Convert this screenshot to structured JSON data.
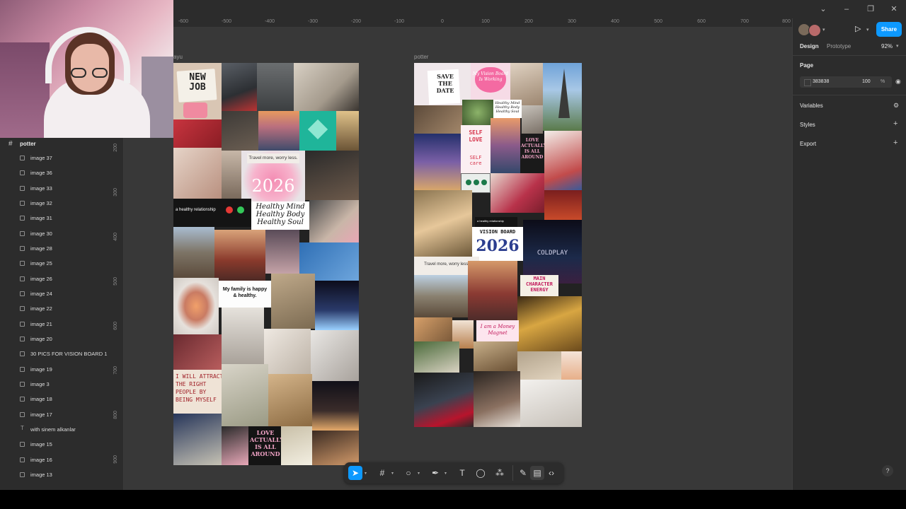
{
  "header": {
    "share_label": "Share",
    "mode_tabs": [
      "Design",
      "Prototype"
    ],
    "zoom": "92%"
  },
  "ruler": {
    "h_ticks": [
      "-600",
      "-500",
      "-400",
      "-300",
      "-200",
      "-100",
      "0",
      "100",
      "200",
      "300",
      "400",
      "500",
      "600",
      "700",
      "800"
    ],
    "v_ticks": [
      "200",
      "300",
      "400",
      "500",
      "600",
      "700",
      "800",
      "900"
    ]
  },
  "frames": [
    {
      "label": "ayu"
    },
    {
      "label": "potter"
    }
  ],
  "layers": {
    "root": "potter",
    "items": [
      {
        "label": "image 37",
        "kind": "image"
      },
      {
        "label": "image 36",
        "kind": "image"
      },
      {
        "label": "image 33",
        "kind": "image"
      },
      {
        "label": "image 32",
        "kind": "image"
      },
      {
        "label": "image 31",
        "kind": "image"
      },
      {
        "label": "image 30",
        "kind": "image"
      },
      {
        "label": "image 28",
        "kind": "image"
      },
      {
        "label": "image 25",
        "kind": "image"
      },
      {
        "label": "image 26",
        "kind": "image"
      },
      {
        "label": "image 24",
        "kind": "image"
      },
      {
        "label": "image 22",
        "kind": "image"
      },
      {
        "label": "image 21",
        "kind": "image"
      },
      {
        "label": "image 20",
        "kind": "image"
      },
      {
        "label": "30 PICS FOR VISION BOARD 1",
        "kind": "image"
      },
      {
        "label": "image 19",
        "kind": "image"
      },
      {
        "label": "image 3",
        "kind": "image"
      },
      {
        "label": "image 18",
        "kind": "image"
      },
      {
        "label": "image 17",
        "kind": "image"
      },
      {
        "label": "with sinem alkanlar",
        "kind": "text"
      },
      {
        "label": "image 15",
        "kind": "image"
      },
      {
        "label": "image 16",
        "kind": "image"
      },
      {
        "label": "image 13",
        "kind": "image"
      }
    ]
  },
  "right_panel": {
    "page_heading": "Page",
    "page_color": "383838",
    "page_opacity": "100",
    "page_opacity_unit": "%",
    "sections": [
      "Variables",
      "Styles",
      "Export"
    ]
  },
  "board_texts": {
    "new_job": "NEW\nJOB",
    "travel": "Travel more, worry less.",
    "year": "2026",
    "relationship": "a healthy relationship",
    "healthy": "Healthy Mind\nHealthy Body\nHealthy Soul",
    "family": "My family is happy\n& healthy.",
    "attract": "I WILL ATTRACT\nTHE RIGHT\nPEOPLE BY\nBEING MYSELF",
    "love": "LOVE\nACTUALLY\nIS ALL\nAROUND",
    "save_date": "SAVE\nTHE\nDATE",
    "vision_heart": "My Vision Board\nIs Working",
    "self_love": "SELF\nLOVE",
    "self_care": "SELF\ncare",
    "vision_board": "VISION BOARD",
    "main_character": "MAIN\nCHARACTER\nENERGY",
    "money": "I am a Money\nMagnet",
    "coldplay": "COLDPLAY"
  },
  "colors": {
    "accent": "#0d99ff",
    "canvas": "#383838",
    "panel": "#2c2c2c"
  }
}
